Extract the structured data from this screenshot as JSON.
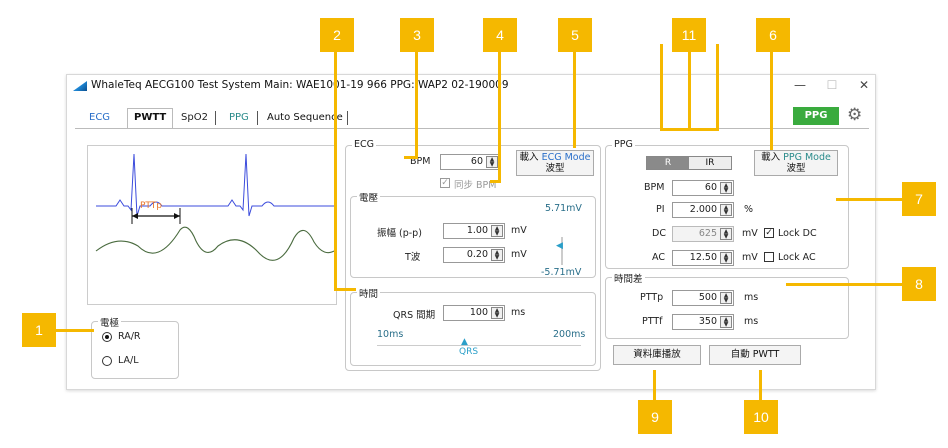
{
  "window": {
    "title": "WhaleTeq AECG100 Test System   Main: WAE1001-19 966  PPG: WAP2 02-190009",
    "min": "—",
    "max": "☐",
    "close": "✕"
  },
  "tabs": {
    "ecg": "ECG",
    "pwtt": "PWTT",
    "spo2": "SpO2",
    "ppg": "PPG",
    "auto": "Auto Sequence"
  },
  "header": {
    "ppg_badge": "PPG"
  },
  "waveform": {
    "pttp_label": "PTTp"
  },
  "electrode": {
    "title": "電極",
    "options": [
      "RA/R",
      "LA/L"
    ],
    "selected": "RA/R"
  },
  "ecg": {
    "title": "ECG",
    "bpm_label": "BPM",
    "bpm_value": "60",
    "load_btn_line1_prefix": "載入 ",
    "load_btn_line1_mode": "ECG Mode",
    "load_btn_line2": "波型",
    "sync_label": "同步 BPM",
    "voltage": {
      "title": "電壓",
      "top_scale": "5.71mV",
      "bottom_scale": "-5.71mV",
      "amp_label": "振幅 (p-p)",
      "amp_value": "1.00",
      "amp_unit": "mV",
      "t_label": "T波",
      "t_value": "0.20",
      "t_unit": "mV"
    },
    "time": {
      "title": "時間",
      "qrs_label": "QRS 間期",
      "qrs_value": "100",
      "qrs_unit": "ms",
      "min": "10ms",
      "max": "200ms",
      "slider_label": "QRS"
    }
  },
  "ppg": {
    "title": "PPG",
    "r_label": "R",
    "ir_label": "IR",
    "load_btn_line1_prefix": "載入 ",
    "load_btn_line1_mode": "PPG Mode",
    "load_btn_line2": "波型",
    "bpm_label": "BPM",
    "bpm_value": "60",
    "pi_label": "PI",
    "pi_value": "2.000",
    "pi_unit": "%",
    "dc_label": "DC",
    "dc_value": "625",
    "dc_unit": "mV",
    "lock_dc": "Lock DC",
    "ac_label": "AC",
    "ac_value": "12.50",
    "ac_unit": "mV",
    "lock_ac": "Lock AC",
    "timing": {
      "title": "時間差",
      "pttp_label": "PTTp",
      "pttp_value": "500",
      "pttp_unit": "ms",
      "pttf_label": "PTTf",
      "pttf_value": "350",
      "pttf_unit": "ms"
    }
  },
  "buttons": {
    "db_play": "資料庫播放",
    "auto_pwtt": "自動 PWTT"
  },
  "callouts": [
    "1",
    "2",
    "3",
    "4",
    "5",
    "6",
    "7",
    "8",
    "9",
    "10",
    "11"
  ],
  "colors": {
    "callout": "#f5b800",
    "ecg_wave": "#3b4bdc",
    "ppg_wave": "#4a6b3f",
    "ppg_badge": "#3aab3e"
  }
}
